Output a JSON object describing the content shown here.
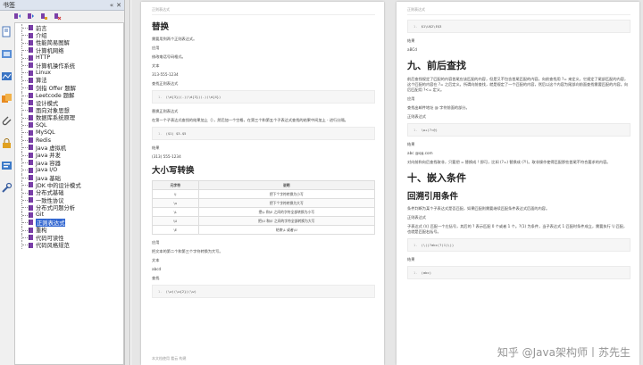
{
  "panel": {
    "title": "书签",
    "close": "✕",
    "collapse": "«"
  },
  "bookmarks": [
    "前言",
    "介绍",
    "性能简易图解",
    "计算机网络",
    "HTTP",
    "计算机操作系统",
    "Linux",
    "算法",
    "剑指 Offer 题解",
    "Leetcode 题解",
    "设计模式",
    "面向对象思想",
    "数据库系统原理",
    "SQL",
    "MySQL",
    "Redis",
    "Java 虚拟机",
    "Java 并发",
    "Java 容器",
    "Java I/O",
    "Java 基础",
    "JDK 中的设计模式",
    "分布式基础",
    "一致性协议",
    "分布式问题分析",
    "Git",
    "正则表达式",
    "重构",
    "代码可读性",
    "代码风格规范"
  ],
  "selected_index": 26,
  "left_page": {
    "header": "正则表达式",
    "h_replace": "替换",
    "t1": "需要用到两个正则表达式。",
    "l_apply": "应用",
    "t2": "修改电话号码格式。",
    "l_text": "文本",
    "phone": "313-555-1234",
    "l_regex": "查找正则表达式",
    "code1": "(\\d{3})(-)(\\d{3})(-)(\\d{4})",
    "l_replace_regex": "替换正则表达式",
    "t3": "在第一个子表达式查找的结果加上（），然后加一个空格，在第三个和第五个子表达式查找的结果中间加上 - 进行分隔。",
    "code2": "($1) $3-$5",
    "l_result": "结果",
    "result": "(313) 555-1234",
    "h_case": "大小写转换",
    "table_head": [
      "元字符",
      "说明"
    ],
    "table_rows": [
      [
        "\\l",
        "把下个字符转换为小写"
      ],
      [
        "\\u",
        "把下个字符转换为大写"
      ],
      [
        "\\L",
        "把\\L 和\\E 之间的字符全部转换为小写"
      ],
      [
        "\\U",
        "把\\U 和\\E 之间的字符全部转换为大写"
      ],
      [
        "\\E",
        "结束\\L 或者\\U"
      ]
    ],
    "l_apply2": "应用",
    "t4": "把文本的第二个和第三个字符转换为大写。",
    "l_text2": "文本",
    "text2": "abcd",
    "l_find": "查找",
    "code3": "(\\w)(\\w{2})(\\w)",
    "footer": "本文档使用 看云 构建"
  },
  "right_page": {
    "header": "正则表达式",
    "code_top": "$1\\U$2\\E$3",
    "l_result": "结果",
    "result": "aBCd",
    "h_lookaround": "九、前后查找",
    "t1": "前后查找规定了匹配的内容首尾应该匹配的内容，但是又不包含首尾匹配的内容。向前查找用 ?= 来定义，它规定了尾部匹配的内容，这个匹配的内容在 ?= 之后定义。所谓向前查找，就是规定了一个匹配的内容，然后以这个内容为尾部向前面查找需要匹配的内容。向后匹配用 ?<= 定义。",
    "l_apply": "应用",
    "t2": "查找出邮件地址 @ 字符前面的部分。",
    "l_regex": "正则表达式",
    "code1": "\\w+(?=@)",
    "l_result2": "结果",
    "result2": "abc @qq.com",
    "t3": "对向前和向后查找取非，只要把 = 替换成 ! 即可，比如 (?=) 替换成 (?!)。取非操作使得匹配那些首尾不符合要求的内容。",
    "h_embed": "十、嵌入条件",
    "h_backref": "回溯引用条件",
    "t4": "条件判断为某个子表达式是否匹配，如果匹配则需要继续匹配条件表达式后面的内容。",
    "l_regex2": "正则表达式",
    "t5": "子表达式 (\\() 匹配一个左括号，其后的 ? 表示匹配 0 个或者 1 个。?(1) 为条件，当子表达式 1 匹配时条件成立，需要执行 \\) 匹配，也就是匹配右括号。",
    "code2": "(\\()?abc(?(1)\\))",
    "l_result3": "结果",
    "result3": "(abc)"
  },
  "watermark": "知乎 @Java架构师丨苏先生",
  "colors": {
    "bookmark_icon": "#7a3fa8",
    "selection": "#3166d1",
    "panel_bg": "#f0f0f0",
    "viewer_bg": "#e6e6e6"
  }
}
